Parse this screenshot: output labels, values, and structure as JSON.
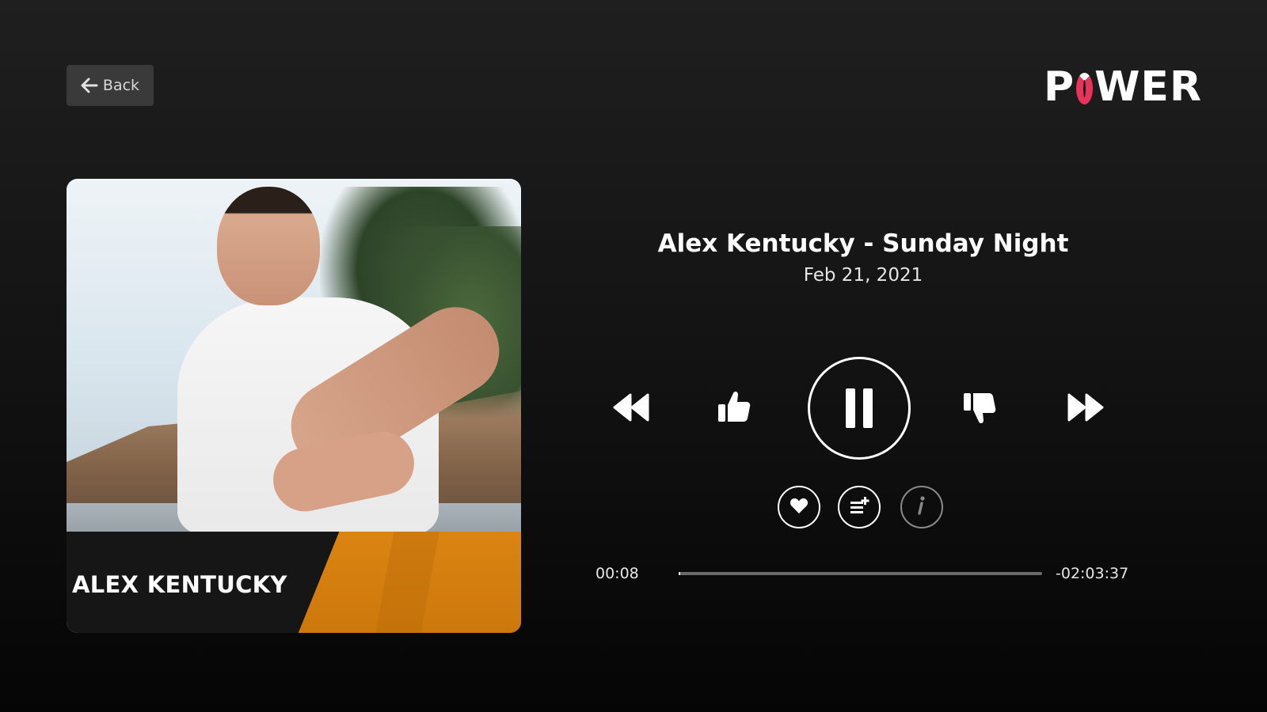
{
  "header": {
    "back_label": "Back",
    "logo_text": {
      "prefix": "P",
      "suffix": "WER"
    }
  },
  "artwork": {
    "artist_label": "ALEX KENTUCKY"
  },
  "track": {
    "title": "Alex Kentucky - Sunday Night",
    "date": "Feb 21, 2021"
  },
  "controls": {
    "icons": [
      "rewind-icon",
      "thumbs-up-icon",
      "pause-icon",
      "thumbs-down-icon",
      "fast-forward-icon"
    ],
    "secondary_icons": [
      "heart-icon",
      "add-to-queue-icon",
      "info-icon"
    ]
  },
  "progress": {
    "elapsed": "00:08",
    "remaining": "-02:03:37",
    "fraction": 0.001
  },
  "colors": {
    "brand_accent": "#e8335a",
    "artwork_band": "#e58a12"
  }
}
